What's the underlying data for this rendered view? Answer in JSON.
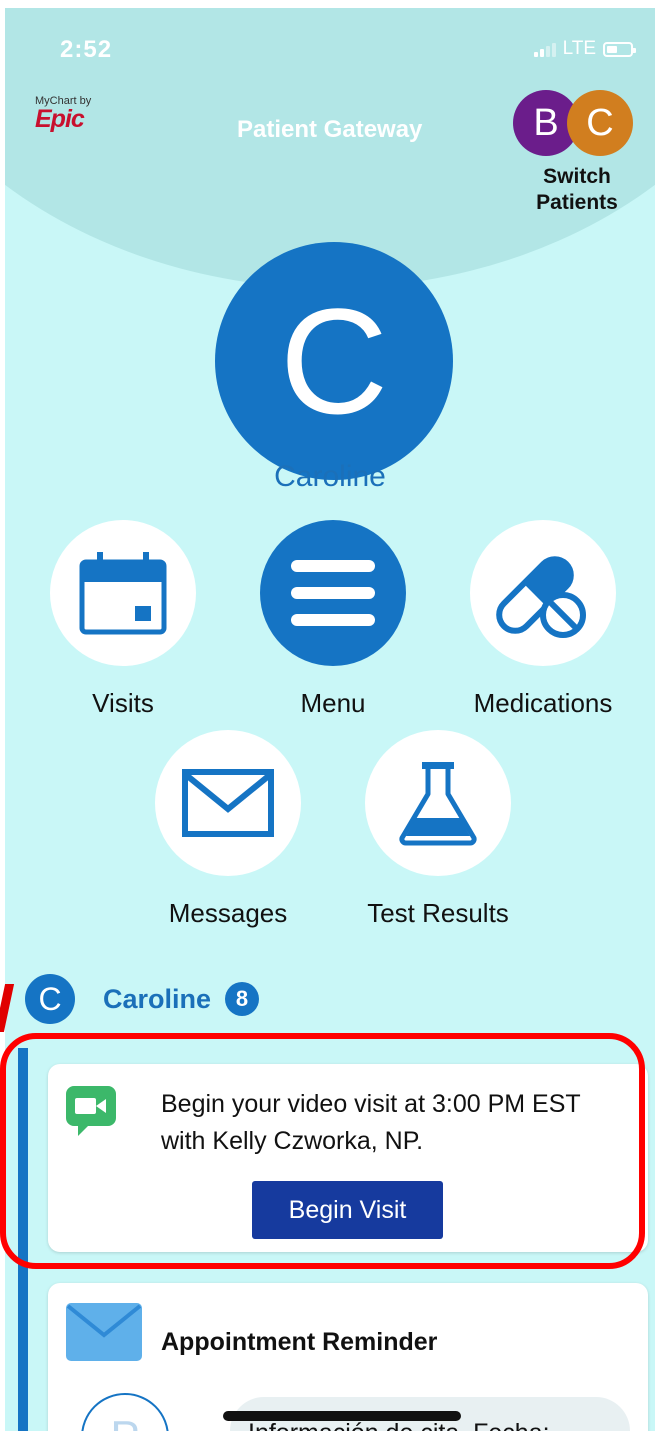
{
  "status_bar": {
    "time": "2:52",
    "network": "LTE"
  },
  "header": {
    "logo_small": "MyChart by",
    "logo_big": "Epic",
    "title": "Patient Gateway"
  },
  "switch_patients": {
    "avatars": [
      "B",
      "C"
    ],
    "label_line1": "Switch",
    "label_line2": "Patients",
    "colors": {
      "b": "#6b1d8b",
      "c": "#d17e1f"
    }
  },
  "profile": {
    "initial": "C",
    "name": "Caroline"
  },
  "tiles": [
    {
      "label": "Visits",
      "icon": "calendar-icon"
    },
    {
      "label": "Menu",
      "icon": "hamburger-menu-icon"
    },
    {
      "label": "Medications",
      "icon": "pill-icon"
    },
    {
      "label": "Messages",
      "icon": "envelope-icon"
    },
    {
      "label": "Test Results",
      "icon": "flask-icon"
    }
  ],
  "feed": {
    "patient_initial": "C",
    "patient_name": "Caroline",
    "badge_count": "8",
    "cards": [
      {
        "icon": "video-chat-icon",
        "text": "Begin your video visit at 3:00 PM EST with Kelly Czworka, NP.",
        "button_label": "Begin Visit"
      },
      {
        "icon": "envelope-icon",
        "title": "Appointment Reminder",
        "sender_initial": "P",
        "preview": "Información de cita. Fecha:"
      }
    ]
  },
  "colors": {
    "background": "#c9f7f7",
    "header_arc": "#b2e6e6",
    "primary": "#1574c4",
    "button": "#163a9e",
    "highlight": "#ff0000"
  }
}
